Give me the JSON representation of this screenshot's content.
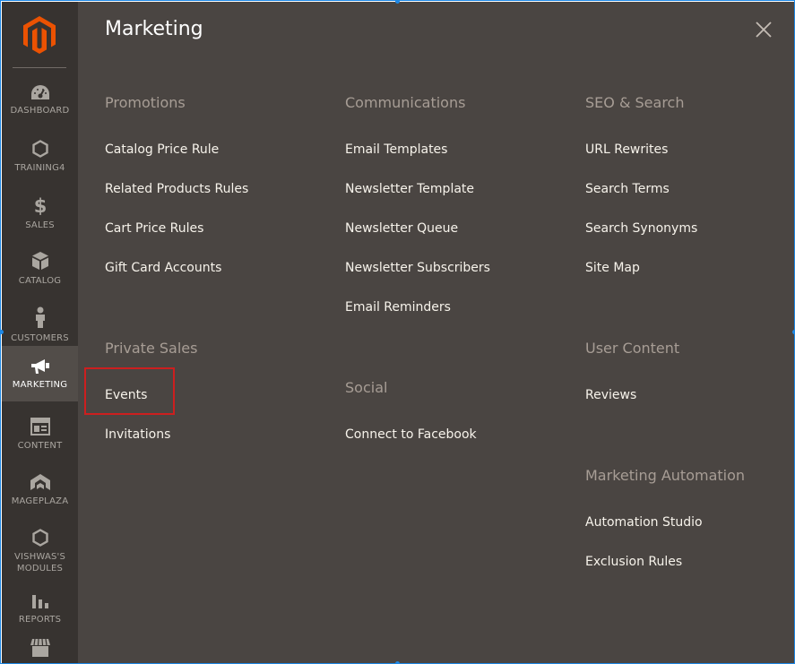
{
  "sidebar": {
    "items": [
      {
        "label": "DASHBOARD",
        "icon": "dashboard-icon"
      },
      {
        "label": "TRAINING4",
        "icon": "hexagon-icon"
      },
      {
        "label": "SALES",
        "icon": "dollar-icon"
      },
      {
        "label": "CATALOG",
        "icon": "box-icon"
      },
      {
        "label": "CUSTOMERS",
        "icon": "person-icon"
      },
      {
        "label": "MARKETING",
        "icon": "megaphone-icon",
        "active": true
      },
      {
        "label": "CONTENT",
        "icon": "layout-icon"
      },
      {
        "label": "MAGEPLAZA",
        "icon": "mageplaza-icon"
      },
      {
        "label": "VISHWAS'S MODULES",
        "icon": "hexagon-icon"
      },
      {
        "label": "REPORTS",
        "icon": "bar-chart-icon"
      },
      {
        "label": "",
        "icon": "store-icon"
      }
    ]
  },
  "panel": {
    "title": "Marketing",
    "close_icon": "close-icon"
  },
  "sections": {
    "promotions": {
      "heading": "Promotions",
      "links": [
        "Catalog Price Rule",
        "Related Products Rules",
        "Cart Price Rules",
        "Gift Card Accounts"
      ]
    },
    "private_sales": {
      "heading": "Private Sales",
      "links": [
        "Events",
        "Invitations"
      ]
    },
    "communications": {
      "heading": "Communications",
      "links": [
        "Email Templates",
        "Newsletter Template",
        "Newsletter Queue",
        "Newsletter Subscribers",
        "Email Reminders"
      ]
    },
    "social": {
      "heading": "Social",
      "links": [
        "Connect to Facebook"
      ]
    },
    "seo_search": {
      "heading": "SEO & Search",
      "links": [
        "URL Rewrites",
        "Search Terms",
        "Search Synonyms",
        "Site Map"
      ]
    },
    "user_content": {
      "heading": "User Content",
      "links": [
        "Reviews"
      ]
    },
    "marketing_automation": {
      "heading": "Marketing Automation",
      "links": [
        "Automation Studio",
        "Exclusion Rules"
      ]
    }
  },
  "colors": {
    "sidebar_bg": "#373330",
    "panel_bg": "#4a4542",
    "active_item_bg": "#524d49",
    "heading": "#a79d95",
    "link": "#f7f3eb",
    "logo_orange": "#eb5202",
    "highlight": "#cc1f1f"
  }
}
